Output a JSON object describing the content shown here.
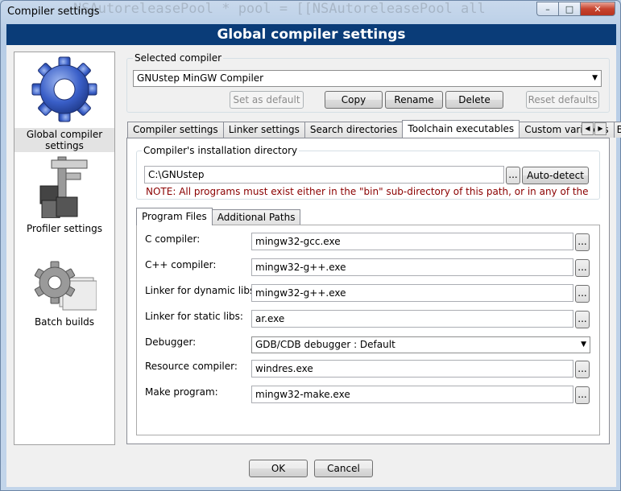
{
  "window": {
    "title": "Compiler settings",
    "caption_min": "–",
    "caption_max": "□",
    "caption_close": "✕"
  },
  "banner": {
    "title": "Global compiler settings"
  },
  "sidebar": {
    "items": [
      {
        "label": "Global compiler settings",
        "icon": "gear-icon"
      },
      {
        "label": "Profiler settings",
        "icon": "caliper-icon"
      },
      {
        "label": "Batch builds",
        "icon": "batch-gear-icon"
      }
    ]
  },
  "compiler": {
    "selected_label": "Selected compiler",
    "selected_value": "GNUstep MinGW Compiler",
    "buttons": {
      "set_default": "Set as default",
      "copy": "Copy",
      "rename": "Rename",
      "delete": "Delete",
      "reset_defaults": "Reset defaults"
    }
  },
  "tabs": [
    {
      "label": "Compiler settings"
    },
    {
      "label": "Linker settings"
    },
    {
      "label": "Search directories"
    },
    {
      "label": "Toolchain executables",
      "active": true
    },
    {
      "label": "Custom variables"
    },
    {
      "label": "Bui"
    }
  ],
  "toolchain": {
    "install_dir_label": "Compiler's installation directory",
    "install_dir_value": "C:\\GNUstep",
    "browse_label": "...",
    "autodetect_label": "Auto-detect",
    "note": "NOTE: All programs must exist either in the \"bin\" sub-directory of this path, or in any of the",
    "subtabs": [
      {
        "label": "Program Files",
        "active": true
      },
      {
        "label": "Additional Paths"
      }
    ],
    "programs": [
      {
        "label": "C compiler:",
        "value": "mingw32-gcc.exe",
        "type": "text"
      },
      {
        "label": "C++ compiler:",
        "value": "mingw32-g++.exe",
        "type": "text"
      },
      {
        "label": "Linker for dynamic libs:",
        "value": "mingw32-g++.exe",
        "type": "text"
      },
      {
        "label": "Linker for static libs:",
        "value": "ar.exe",
        "type": "text"
      },
      {
        "label": "Debugger:",
        "value": "GDB/CDB debugger : Default",
        "type": "combo"
      },
      {
        "label": "Resource compiler:",
        "value": "windres.exe",
        "type": "text"
      },
      {
        "label": "Make program:",
        "value": "mingw32-make.exe",
        "type": "text"
      }
    ]
  },
  "footer": {
    "ok": "OK",
    "cancel": "Cancel"
  },
  "background_text": "NSAutoreleasePool * pool = [[NSAutoreleasePool all"
}
